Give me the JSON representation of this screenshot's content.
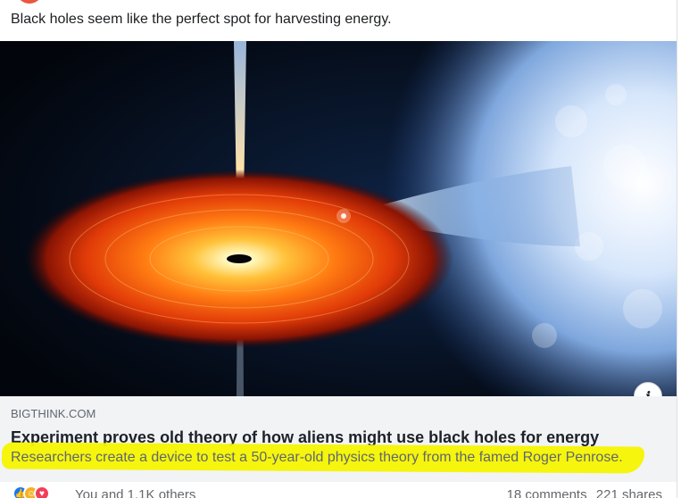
{
  "post": {
    "text": "Black holes seem like the perfect spot for harvesting energy."
  },
  "link_preview": {
    "domain": "BIGTHINK.COM",
    "headline": "Experiment proves old theory of how aliens might use black holes for energy",
    "description": "Researchers create a device to test a 50-year-old physics theory from the famed Roger Penrose.",
    "info_label": "i",
    "highlight_color": "#f6f400"
  },
  "footer": {
    "reaction_icons": [
      "like-icon",
      "care-icon",
      "love-icon"
    ],
    "reaction_text": "You and 1.1K others",
    "comments": "18 comments",
    "shares": "221 shares"
  }
}
